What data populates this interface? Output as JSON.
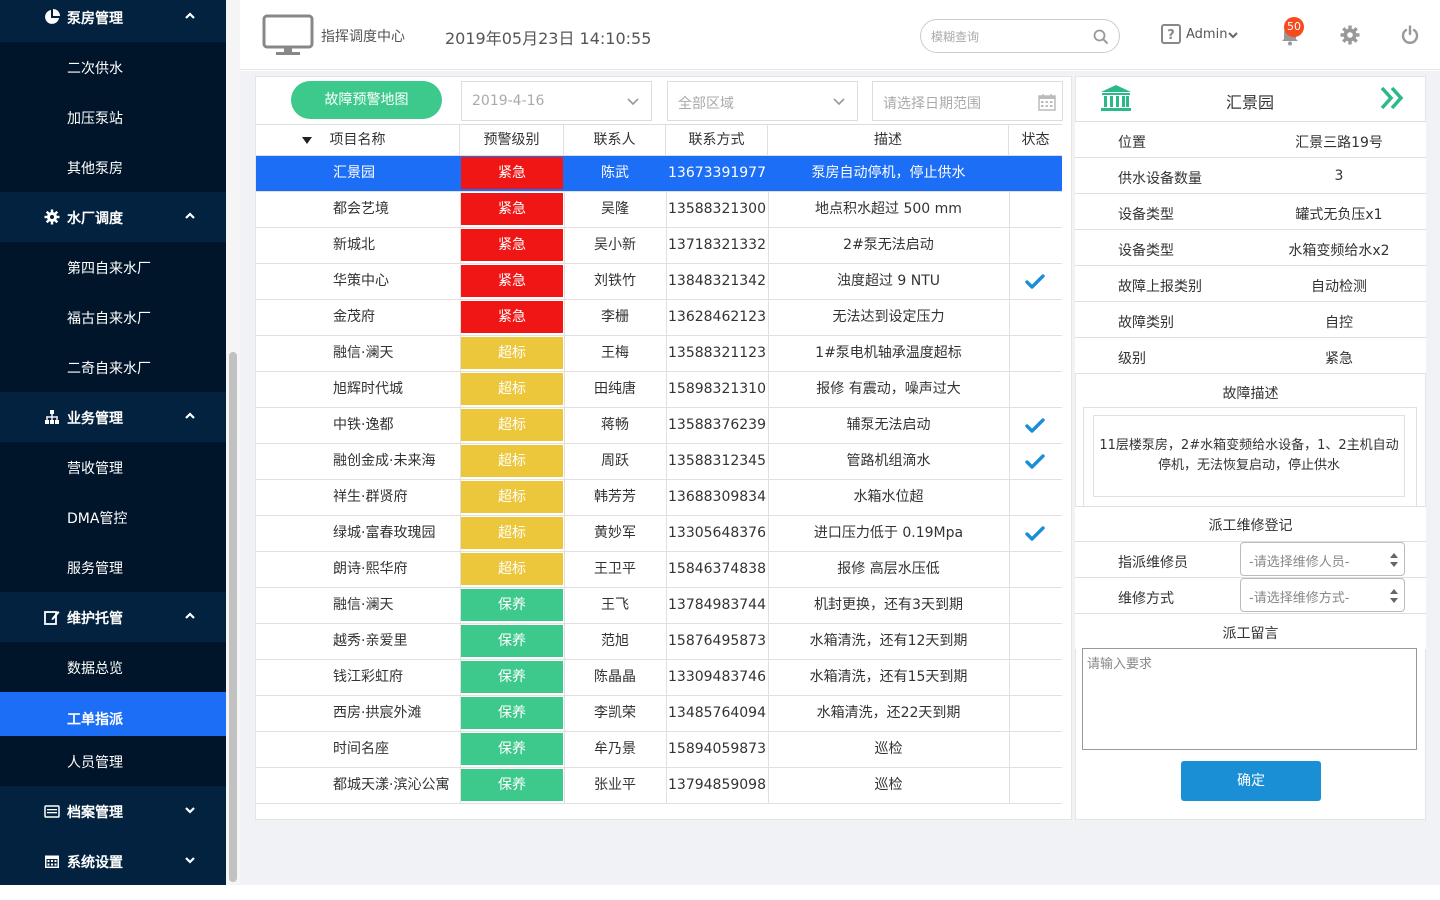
{
  "colors": {
    "sidebar_bg": "#001529",
    "group_bg": "#03223f",
    "active": "#1c6ef6",
    "urgent": "#f01616",
    "exceed": "#ecc73b",
    "maintain": "#3ec98c",
    "confirm": "#1a8fd6"
  },
  "sidebar": {
    "groups": [
      {
        "label": "泵房管理",
        "icon": "pie-chart-icon",
        "expanded": true,
        "items": [
          "二次供水",
          "加压泵站",
          "其他泵房"
        ]
      },
      {
        "label": "水厂调度",
        "icon": "gear-icon",
        "expanded": true,
        "items": [
          "第四自来水厂",
          "福古自来水厂",
          "二奇自来水厂"
        ]
      },
      {
        "label": "业务管理",
        "icon": "sitemap-icon",
        "expanded": true,
        "items": [
          "营收管理",
          "DMA管控",
          "服务管理"
        ]
      },
      {
        "label": "维护托管",
        "icon": "edit-icon",
        "expanded": true,
        "items": [
          "数据总览",
          "工单指派",
          "人员管理"
        ]
      },
      {
        "label": "档案管理",
        "icon": "archive-icon",
        "expanded": false,
        "items": []
      },
      {
        "label": "系统设置",
        "icon": "calendar-icon",
        "expanded": false,
        "items": []
      }
    ],
    "active_item": "工单指派"
  },
  "header": {
    "title": "指挥调度中心",
    "datetime": "2019年05月23日 14:10:55",
    "search_placeholder": "模糊查询",
    "user": "Admin",
    "notifications": "50"
  },
  "toolbar": {
    "map_button": "故障预警地图",
    "date_filter": "2019-4-16",
    "region_filter": "全部区域",
    "range_placeholder": "请选择日期范围"
  },
  "table": {
    "columns": [
      "项目名称",
      "预警级别",
      "联系人",
      "联系方式",
      "描述",
      "状态"
    ],
    "rows": [
      {
        "name": "汇景园",
        "level": "紧急",
        "contact": "陈武",
        "phone": "13673391977",
        "desc": "泵房自动停机，停止供水",
        "done": false,
        "selected": true
      },
      {
        "name": "都会艺境",
        "level": "紧急",
        "contact": "吴隆",
        "phone": "13588321300",
        "desc": "地点积水超过 500 mm",
        "done": false
      },
      {
        "name": "新城北",
        "level": "紧急",
        "contact": "吴小新",
        "phone": "13718321332",
        "desc": "2#泵无法启动",
        "done": false
      },
      {
        "name": "华策中心",
        "level": "紧急",
        "contact": "刘铁竹",
        "phone": "13848321342",
        "desc": "浊度超过 9 NTU",
        "done": true
      },
      {
        "name": "金茂府",
        "level": "紧急",
        "contact": "李栅",
        "phone": "13628462123",
        "desc": "无法达到设定压力",
        "done": false
      },
      {
        "name": "融信·澜天",
        "level": "超标",
        "contact": "王梅",
        "phone": "13588321123",
        "desc": "1#泵电机轴承温度超标",
        "done": false
      },
      {
        "name": "旭辉时代城",
        "level": "超标",
        "contact": "田纯唐",
        "phone": "15898321310",
        "desc": "报修 有震动，噪声过大",
        "done": false
      },
      {
        "name": "中铁·逸都",
        "level": "超标",
        "contact": "蒋畅",
        "phone": "13588376239",
        "desc": "辅泵无法启动",
        "done": true
      },
      {
        "name": "融创金成·未来海",
        "level": "超标",
        "contact": "周跃",
        "phone": "13588312345",
        "desc": "管路机组滴水",
        "done": true
      },
      {
        "name": "祥生·群贤府",
        "level": "超标",
        "contact": "韩芳芳",
        "phone": "13688309834",
        "desc": "水箱水位超",
        "done": false
      },
      {
        "name": "绿城·富春玫瑰园",
        "level": "超标",
        "contact": "黄妙军",
        "phone": "13305648376",
        "desc": "进口压力低于 0.19Mpa",
        "done": true
      },
      {
        "name": "朗诗·熙华府",
        "level": "超标",
        "contact": "王卫平",
        "phone": "15846374838",
        "desc": "报修 高层水压低",
        "done": false
      },
      {
        "name": "融信·澜天",
        "level": "保养",
        "contact": "王飞",
        "phone": "13784983744",
        "desc": "机封更换，还有3天到期",
        "done": false
      },
      {
        "name": "越秀·亲爱里",
        "level": "保养",
        "contact": "范旭",
        "phone": "15876495873",
        "desc": "水箱清洗，还有12天到期",
        "done": false
      },
      {
        "name": "钱江彩虹府",
        "level": "保养",
        "contact": "陈晶晶",
        "phone": "13309483746",
        "desc": "水箱清洗，还有15天到期",
        "done": false
      },
      {
        "name": "西房·拱宸外滩",
        "level": "保养",
        "contact": "李凯荣",
        "phone": "13485764094",
        "desc": "水箱清洗，还22天到期",
        "done": false
      },
      {
        "name": "时间名座",
        "level": "保养",
        "contact": "牟乃景",
        "phone": "15894059873",
        "desc": "巡检",
        "done": false
      },
      {
        "name": "都城天漾·滨沁公寓",
        "level": "保养",
        "contact": "张业平",
        "phone": "13794859098",
        "desc": "巡检",
        "done": false
      }
    ]
  },
  "detail": {
    "title": "汇景园",
    "fields": [
      {
        "k": "位置",
        "v": "汇景三路19号"
      },
      {
        "k": "供水设备数量",
        "v": "3"
      },
      {
        "k": "设备类型",
        "v": "罐式无负压x1"
      },
      {
        "k": "设备类型",
        "v": "水箱变频给水x2"
      },
      {
        "k": "故障上报类别",
        "v": "自动检测"
      },
      {
        "k": "故障类别",
        "v": "自控"
      },
      {
        "k": "级别",
        "v": "紧急"
      }
    ],
    "desc_title": "故障描述",
    "desc_text": "11层楼泵房，2#水箱变频给水设备，1、2主机自动停机，无法恢复启动，停止供水",
    "dispatch_title": "派工维修登记",
    "staff_label": "指派维修员",
    "staff_select": "-请选择维修人员-",
    "method_label": "维修方式",
    "method_select": "-请选择维修方式-",
    "note_title": "派工留言",
    "note_placeholder": "请输入要求",
    "confirm_label": "确定"
  }
}
